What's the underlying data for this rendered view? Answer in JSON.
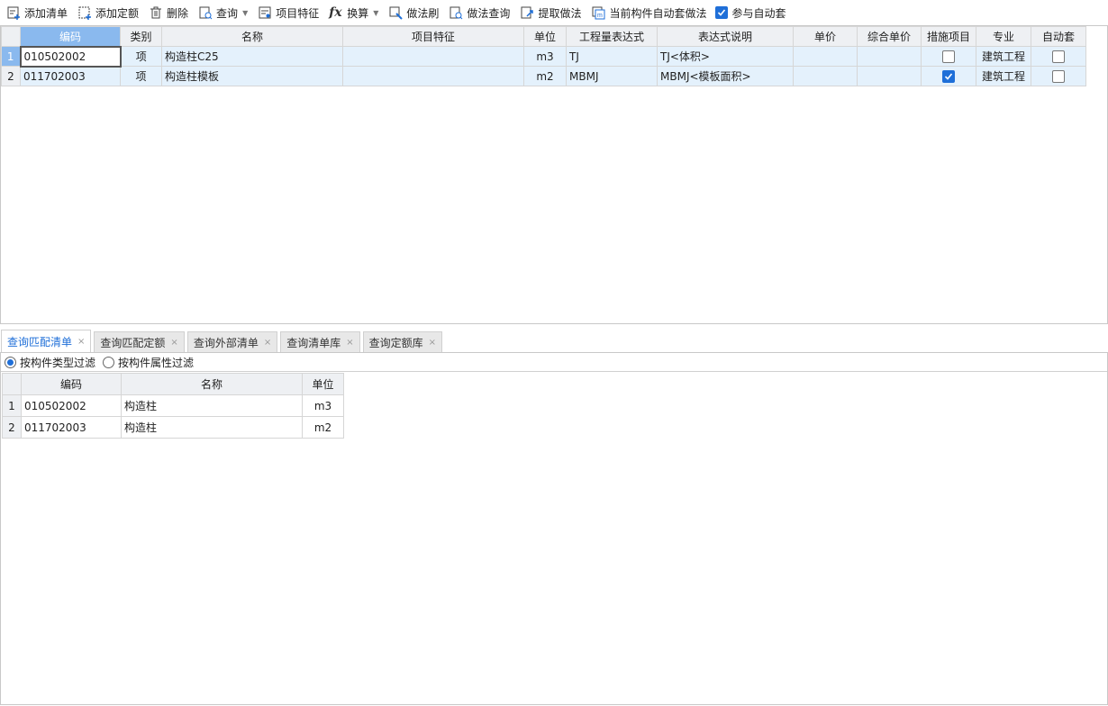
{
  "toolbar": {
    "add_list": "添加清单",
    "add_quota": "添加定额",
    "delete": "删除",
    "query": "查询",
    "item_feature": "项目特征",
    "convert": "换算",
    "method_brush": "做法刷",
    "method_query": "做法查询",
    "extract_method": "提取做法",
    "auto_method": "当前构件自动套做法",
    "participate_auto": "参与自动套"
  },
  "top_grid": {
    "headers": [
      "编码",
      "类别",
      "名称",
      "项目特征",
      "单位",
      "工程量表达式",
      "表达式说明",
      "单价",
      "综合单价",
      "措施项目",
      "专业",
      "自动套"
    ],
    "rows": [
      {
        "no": "1",
        "code": "010502002",
        "type": "项",
        "name": "构造柱C25",
        "feature": "",
        "unit": "m3",
        "expr": "TJ",
        "expr_desc": "TJ<体积>",
        "price": "",
        "comp_price": "",
        "measure": false,
        "major": "建筑工程",
        "auto": false
      },
      {
        "no": "2",
        "code": "011702003",
        "type": "项",
        "name": "构造柱模板",
        "feature": "",
        "unit": "m2",
        "expr": "MBMJ",
        "expr_desc": "MBMJ<模板面积>",
        "price": "",
        "comp_price": "",
        "measure": true,
        "major": "建筑工程",
        "auto": false
      }
    ]
  },
  "tabs": [
    "查询匹配清单",
    "查询匹配定额",
    "查询外部清单",
    "查询清单库",
    "查询定额库"
  ],
  "filter": {
    "by_type": "按构件类型过滤",
    "by_attr": "按构件属性过滤"
  },
  "bottom_grid": {
    "headers": [
      "编码",
      "名称",
      "单位"
    ],
    "rows": [
      {
        "no": "1",
        "code": "010502002",
        "name": "构造柱",
        "unit": "m3"
      },
      {
        "no": "2",
        "code": "011702003",
        "name": "构造柱",
        "unit": "m2"
      }
    ]
  },
  "colors": {
    "accent": "#1f6fd8",
    "selected_header": "#8ab9ee",
    "row_highlight": "#e4f1fc"
  }
}
